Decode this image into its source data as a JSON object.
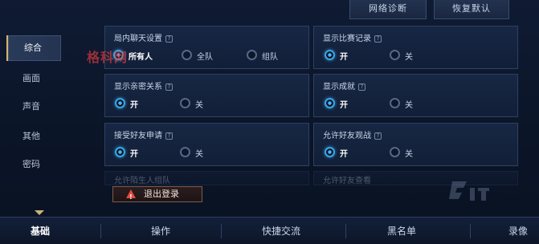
{
  "top_buttons": {
    "network": "网络诊断",
    "reset": "恢复默认"
  },
  "left_nav": [
    {
      "label": "综合",
      "active": true
    },
    {
      "label": "画面",
      "active": false
    },
    {
      "label": "声音",
      "active": false
    },
    {
      "label": "其他",
      "active": false
    },
    {
      "label": "密码",
      "active": false
    }
  ],
  "watermark": "格科网",
  "settings": {
    "chat": {
      "title": "局内聊天设置",
      "options": [
        "所有人",
        "全队",
        "组队"
      ]
    },
    "match_record": {
      "title": "显示比赛记录",
      "options": [
        "开",
        "关"
      ]
    },
    "intimacy": {
      "title": "显示亲密关系",
      "options": [
        "开",
        "关"
      ]
    },
    "achievement": {
      "title": "显示成就",
      "options": [
        "开",
        "关"
      ]
    },
    "friend_request": {
      "title": "接受好友申请",
      "options": [
        "开",
        "关"
      ]
    },
    "friend_watch": {
      "title": "允许好友观战",
      "options": [
        "开",
        "关"
      ]
    },
    "faded_left": {
      "title": "允许陌生人组队"
    },
    "faded_right": {
      "title": "允许好友查看"
    }
  },
  "exit_button": "退出登录",
  "bottom_tabs": [
    "基础",
    "操作",
    "快捷交流",
    "黑名单",
    "录像"
  ],
  "colors": {
    "accent": "#3aa7e8",
    "active_tab_marker": "#d7b56a",
    "warn": "#e34a3f"
  }
}
